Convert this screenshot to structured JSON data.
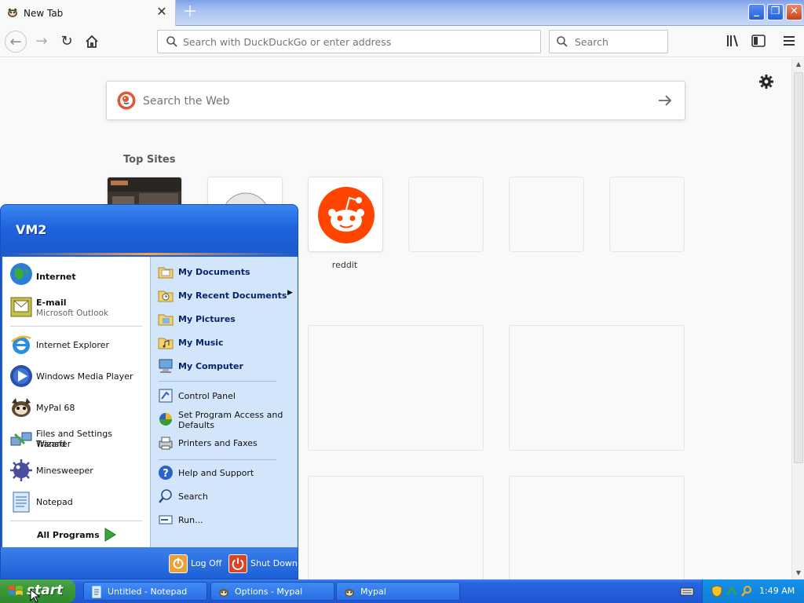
{
  "browser": {
    "tab_title": "New Tab",
    "urlbar_placeholder": "Search with DuckDuckGo or enter address",
    "searchbar_placeholder": "Search"
  },
  "newtab": {
    "websearch_placeholder": "Search the Web",
    "topsites_heading": "Top Sites",
    "tiles": [
      {
        "label": "",
        "kind": "thumbnail"
      },
      {
        "label": "",
        "kind": "wikipedia"
      },
      {
        "label": "reddit",
        "kind": "reddit"
      },
      {
        "label": "",
        "kind": "empty"
      },
      {
        "label": "",
        "kind": "empty"
      },
      {
        "label": "",
        "kind": "empty"
      }
    ]
  },
  "start_menu": {
    "user": "VM2",
    "pinned": [
      {
        "label": "Internet",
        "icon": "globe-icon"
      },
      {
        "label": "E-mail",
        "sub": "Microsoft Outlook",
        "icon": "outlook-icon"
      }
    ],
    "recent": [
      {
        "label": "Internet Explorer",
        "icon": "ie-icon"
      },
      {
        "label": "Windows Media Player",
        "icon": "media-player-icon"
      },
      {
        "label": "MyPal 68",
        "icon": "mypal-icon"
      },
      {
        "label": "Files and Settings Transfer",
        "label2": "Wizard",
        "icon": "transfer-wizard-icon"
      },
      {
        "label": "Minesweeper",
        "icon": "minesweeper-icon"
      },
      {
        "label": "Notepad",
        "icon": "notepad-icon"
      }
    ],
    "all_programs": "All Programs",
    "places": [
      {
        "label": "My Documents"
      },
      {
        "label": "My Recent Documents"
      },
      {
        "label": "My Pictures"
      },
      {
        "label": "My Music"
      },
      {
        "label": "My Computer"
      }
    ],
    "system": [
      {
        "label": "Control Panel"
      },
      {
        "label": "Set Program Access and",
        "label2": "Defaults"
      },
      {
        "label": "Printers and Faxes"
      }
    ],
    "help": [
      {
        "label": "Help and Support"
      },
      {
        "label": "Search"
      },
      {
        "label": "Run..."
      }
    ],
    "log_off": "Log Off",
    "shut_down": "Shut Down"
  },
  "taskbar": {
    "start_label": "start",
    "tasks": [
      {
        "label": "Untitled - Notepad"
      },
      {
        "label": "Options - Mypal"
      },
      {
        "label": "Mypal"
      }
    ],
    "clock": "1:49 AM"
  },
  "colors": {
    "xp_blue": "#245edb",
    "start_green": "#3d983b",
    "reddit_orange": "#ff4500",
    "menu_right_bg": "#d3e5fa"
  }
}
